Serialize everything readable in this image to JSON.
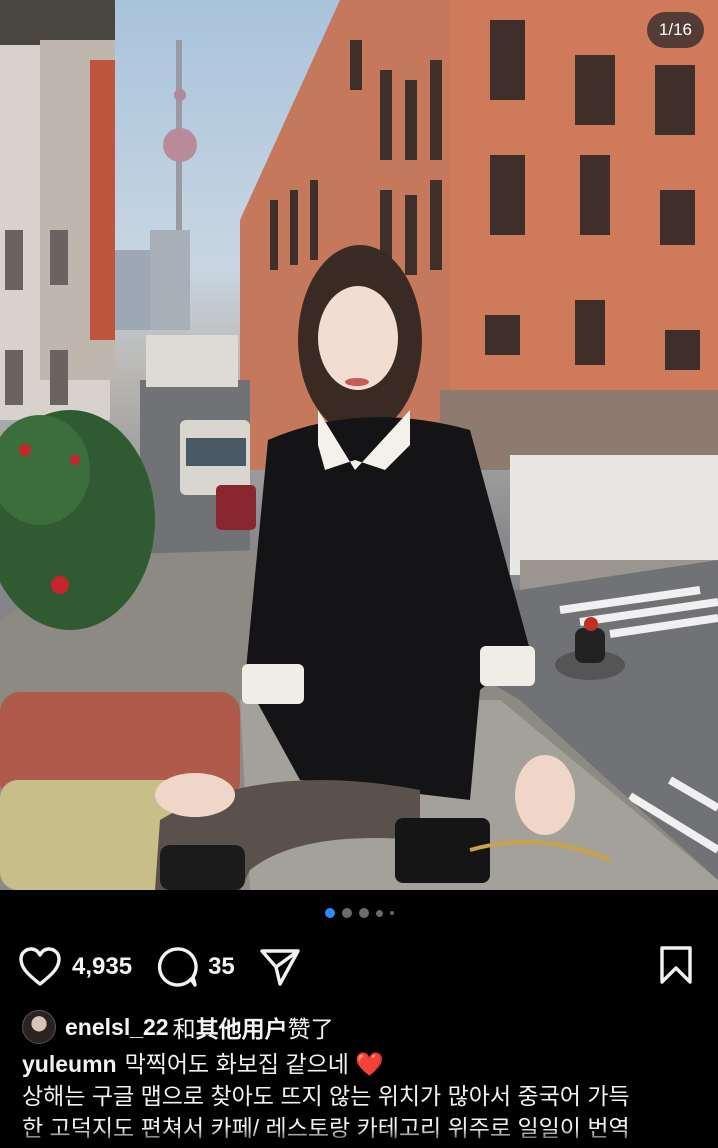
{
  "post": {
    "photo_counter": "1/16",
    "carousel": {
      "total_dots": 5,
      "active_index": 0
    },
    "actions": {
      "likes_count": "4,935",
      "comments_count": "35"
    },
    "liked_by": {
      "username": "enelsl_22",
      "connector": "和",
      "others": "其他用户",
      "suffix": "赞了"
    },
    "caption": {
      "username": "yuleumn",
      "title": "막찍어도 화보집 같으네",
      "emoji": "❤️",
      "line2": "상해는 구글 맵으로 찾아도 뜨지 않는 위치가 많아서 중국어 가득",
      "line3": "한 고덕지도 편쳐서 카페/ 레스토랑 카테고리 위주로 일일이 번역"
    },
    "icons": {
      "like": "heart-icon",
      "comment": "comment-icon",
      "share": "send-icon",
      "save": "bookmark-icon"
    },
    "colors": {
      "background": "#000000",
      "active_dot": "#2f8cff",
      "heart_emoji": "#e0312f"
    }
  }
}
